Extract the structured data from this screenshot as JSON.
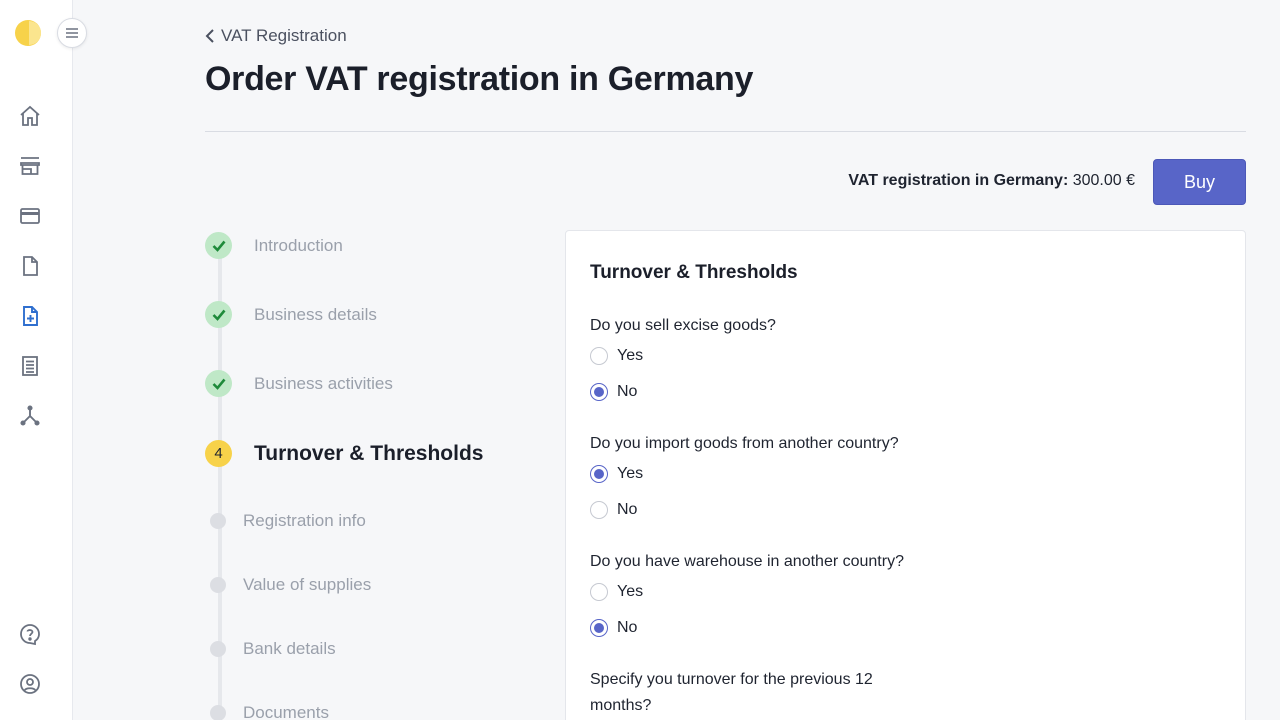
{
  "breadcrumb": {
    "label": "VAT Registration"
  },
  "page": {
    "title": "Order VAT registration in Germany"
  },
  "pricing": {
    "product_label": "VAT registration in Germany:",
    "price": "300.00 €",
    "buy_label": "Buy"
  },
  "sidebar": {
    "icons": [
      "home-icon",
      "store-icon",
      "credit-card-icon",
      "document-icon",
      "document-add-icon",
      "list-icon",
      "network-icon",
      "help-icon",
      "user-icon"
    ],
    "active": "document-add-icon"
  },
  "stepper": {
    "steps": [
      {
        "label": "Introduction",
        "status": "done"
      },
      {
        "label": "Business details",
        "status": "done"
      },
      {
        "label": "Business activities",
        "status": "done"
      },
      {
        "label": "Turnover & Thresholds",
        "status": "current",
        "number": "4"
      },
      {
        "label": "Registration info",
        "status": "pending"
      },
      {
        "label": "Value of supplies",
        "status": "pending"
      },
      {
        "label": "Bank details",
        "status": "pending"
      },
      {
        "label": "Documents",
        "status": "pending"
      }
    ]
  },
  "form": {
    "title": "Turnover & Thresholds",
    "questions": [
      {
        "text": "Do you sell excise goods?",
        "options": [
          {
            "label": "Yes",
            "checked": false
          },
          {
            "label": "No",
            "checked": true
          }
        ]
      },
      {
        "text": "Do you import goods from another country?",
        "options": [
          {
            "label": "Yes",
            "checked": true
          },
          {
            "label": "No",
            "checked": false
          }
        ]
      },
      {
        "text": "Do you have warehouse in another country?",
        "options": [
          {
            "label": "Yes",
            "checked": false
          },
          {
            "label": "No",
            "checked": true
          }
        ]
      },
      {
        "text": "Specify you turnover for the previous 12 months?"
      }
    ]
  },
  "colors": {
    "accent": "#5865c8",
    "brand_yellow": "#f7d24a",
    "done_green": "#bfe8c7",
    "check_green": "#1e8a3a"
  }
}
